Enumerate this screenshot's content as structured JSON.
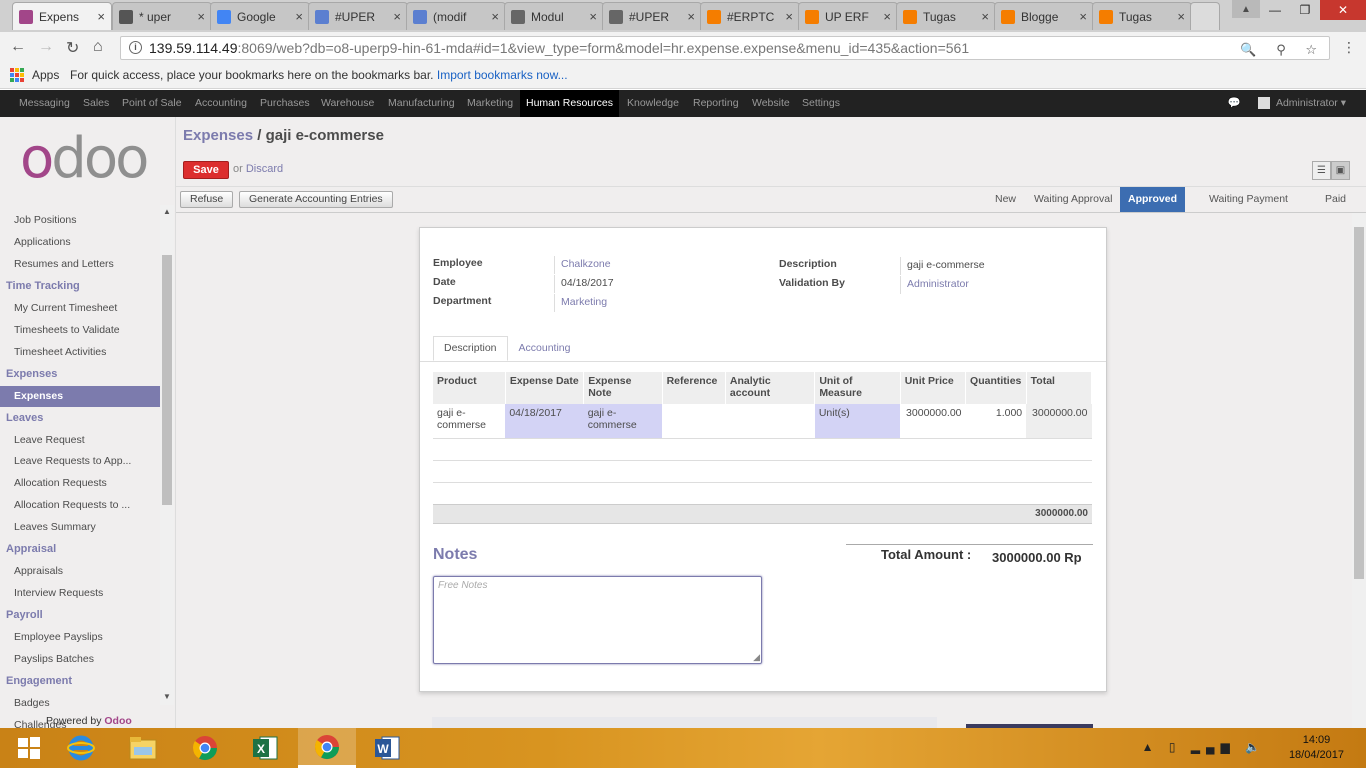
{
  "browser": {
    "tabs": [
      {
        "label": "Expens",
        "active": true,
        "fav_color": "#a24689"
      },
      {
        "label": "* uper",
        "active": false,
        "fav_color": "#555"
      },
      {
        "label": "Google",
        "active": false,
        "fav_color": "#4285f4"
      },
      {
        "label": "#UPER",
        "active": false,
        "fav_color": "#5b7fd0"
      },
      {
        "label": "(modif",
        "active": false,
        "fav_color": "#5b7fd0"
      },
      {
        "label": "Modul",
        "active": false,
        "fav_color": "#666"
      },
      {
        "label": "#UPER",
        "active": false,
        "fav_color": "#666"
      },
      {
        "label": "#ERPTC",
        "active": false,
        "fav_color": "#f57d00"
      },
      {
        "label": "UP ERF",
        "active": false,
        "fav_color": "#f57d00"
      },
      {
        "label": "Tugas",
        "active": false,
        "fav_color": "#f57d00"
      },
      {
        "label": "Blogge",
        "active": false,
        "fav_color": "#f57d00"
      },
      {
        "label": "Tugas",
        "active": false,
        "fav_color": "#f57d00"
      }
    ],
    "tab_close": "×",
    "url_host": "139.59.114.49",
    "url_rest": ":8069/web?db=o8-uperp9-hin-61-mda#id=1&view_type=form&model=hr.expense.expense&menu_id=435&action=561",
    "bookmarks": {
      "apps_label": "Apps",
      "hint": "For quick access, place your bookmarks here on the bookmarks bar.",
      "import_link": "Import bookmarks now..."
    }
  },
  "topmenu": {
    "items": [
      "Messaging",
      "Sales",
      "Point of Sale",
      "Accounting",
      "Purchases",
      "Warehouse",
      "Manufacturing",
      "Marketing",
      "Human Resources",
      "Knowledge",
      "Reporting",
      "Website",
      "Settings"
    ],
    "selected": "Human Resources",
    "user": "Administrator ▾"
  },
  "sidebar": {
    "logo_o": "o",
    "logo_rest": "doo",
    "rows": [
      {
        "type": "item",
        "label": "Job Positions"
      },
      {
        "type": "item",
        "label": "Applications"
      },
      {
        "type": "item",
        "label": "Resumes and Letters"
      },
      {
        "type": "head",
        "label": "Time Tracking"
      },
      {
        "type": "item",
        "label": "My Current Timesheet"
      },
      {
        "type": "item",
        "label": "Timesheets to Validate"
      },
      {
        "type": "item",
        "label": "Timesheet Activities"
      },
      {
        "type": "head",
        "label": "Expenses"
      },
      {
        "type": "sel",
        "label": "Expenses"
      },
      {
        "type": "head",
        "label": "Leaves"
      },
      {
        "type": "item",
        "label": "Leave Request"
      },
      {
        "type": "item",
        "label": "Leave Requests to App..."
      },
      {
        "type": "item",
        "label": "Allocation Requests"
      },
      {
        "type": "item",
        "label": "Allocation Requests to ..."
      },
      {
        "type": "item",
        "label": "Leaves Summary"
      },
      {
        "type": "head",
        "label": "Appraisal"
      },
      {
        "type": "item",
        "label": "Appraisals"
      },
      {
        "type": "item",
        "label": "Interview Requests"
      },
      {
        "type": "head",
        "label": "Payroll"
      },
      {
        "type": "item",
        "label": "Employee Payslips"
      },
      {
        "type": "item",
        "label": "Payslips Batches"
      },
      {
        "type": "head",
        "label": "Engagement"
      },
      {
        "type": "item",
        "label": "Badges"
      },
      {
        "type": "item",
        "label": "Challenges"
      }
    ],
    "powered_by": "Powered by",
    "powered_brand": "Odoo"
  },
  "header": {
    "breadcrumb_parent": "Expenses",
    "breadcrumb_sep": " / ",
    "breadcrumb_current": "gaji e-commerse",
    "save_label": "Save",
    "or_label": "or",
    "discard_label": "Discard"
  },
  "statusbar": {
    "refuse_label": "Refuse",
    "generate_label": "Generate Accounting Entries",
    "stages": [
      "New",
      "Waiting Approval",
      "Approved",
      "Waiting Payment",
      "Paid"
    ],
    "current_stage": "Approved"
  },
  "form": {
    "employee_label": "Employee",
    "employee_value": "Chalkzone",
    "date_label": "Date",
    "date_value": "04/18/2017",
    "department_label": "Department",
    "department_value": "Marketing",
    "description_label": "Description",
    "description_value": "gaji e-commerse",
    "validation_label": "Validation By",
    "validation_value": "Administrator",
    "tabs": [
      "Description",
      "Accounting"
    ],
    "lines_headers": [
      "Product",
      "Expense Date",
      "Expense Note",
      "Reference",
      "Analytic account",
      "Unit of Measure",
      "Unit Price",
      "Quantities",
      "Total"
    ],
    "lines": [
      [
        "gaji e-commerse",
        "04/18/2017",
        "gaji e-commerse",
        "",
        "",
        "Unit(s)",
        "3000000.00",
        "1.000",
        "3000000.00"
      ]
    ],
    "lines_sum": "3000000.00",
    "notes_title": "Notes",
    "notes_placeholder": "Free Notes",
    "total_label": "Total Amount :",
    "total_value": "3000000.00 Rp"
  },
  "taskbar": {
    "time": "14:09",
    "date": "18/04/2017"
  }
}
